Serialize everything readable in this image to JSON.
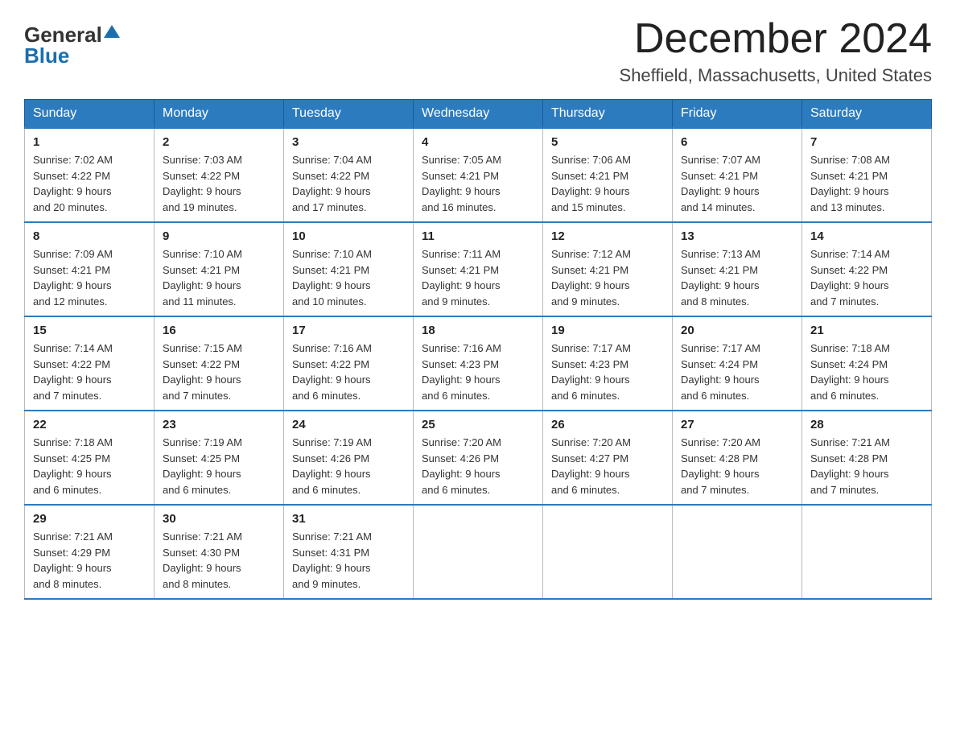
{
  "logo": {
    "general": "General",
    "blue": "Blue"
  },
  "title": {
    "month_year": "December 2024",
    "location": "Sheffield, Massachusetts, United States"
  },
  "days_header": [
    "Sunday",
    "Monday",
    "Tuesday",
    "Wednesday",
    "Thursday",
    "Friday",
    "Saturday"
  ],
  "weeks": [
    [
      {
        "day": "1",
        "sunrise": "7:02 AM",
        "sunset": "4:22 PM",
        "daylight": "9 hours and 20 minutes."
      },
      {
        "day": "2",
        "sunrise": "7:03 AM",
        "sunset": "4:22 PM",
        "daylight": "9 hours and 19 minutes."
      },
      {
        "day": "3",
        "sunrise": "7:04 AM",
        "sunset": "4:22 PM",
        "daylight": "9 hours and 17 minutes."
      },
      {
        "day": "4",
        "sunrise": "7:05 AM",
        "sunset": "4:21 PM",
        "daylight": "9 hours and 16 minutes."
      },
      {
        "day": "5",
        "sunrise": "7:06 AM",
        "sunset": "4:21 PM",
        "daylight": "9 hours and 15 minutes."
      },
      {
        "day": "6",
        "sunrise": "7:07 AM",
        "sunset": "4:21 PM",
        "daylight": "9 hours and 14 minutes."
      },
      {
        "day": "7",
        "sunrise": "7:08 AM",
        "sunset": "4:21 PM",
        "daylight": "9 hours and 13 minutes."
      }
    ],
    [
      {
        "day": "8",
        "sunrise": "7:09 AM",
        "sunset": "4:21 PM",
        "daylight": "9 hours and 12 minutes."
      },
      {
        "day": "9",
        "sunrise": "7:10 AM",
        "sunset": "4:21 PM",
        "daylight": "9 hours and 11 minutes."
      },
      {
        "day": "10",
        "sunrise": "7:10 AM",
        "sunset": "4:21 PM",
        "daylight": "9 hours and 10 minutes."
      },
      {
        "day": "11",
        "sunrise": "7:11 AM",
        "sunset": "4:21 PM",
        "daylight": "9 hours and 9 minutes."
      },
      {
        "day": "12",
        "sunrise": "7:12 AM",
        "sunset": "4:21 PM",
        "daylight": "9 hours and 9 minutes."
      },
      {
        "day": "13",
        "sunrise": "7:13 AM",
        "sunset": "4:21 PM",
        "daylight": "9 hours and 8 minutes."
      },
      {
        "day": "14",
        "sunrise": "7:14 AM",
        "sunset": "4:22 PM",
        "daylight": "9 hours and 7 minutes."
      }
    ],
    [
      {
        "day": "15",
        "sunrise": "7:14 AM",
        "sunset": "4:22 PM",
        "daylight": "9 hours and 7 minutes."
      },
      {
        "day": "16",
        "sunrise": "7:15 AM",
        "sunset": "4:22 PM",
        "daylight": "9 hours and 7 minutes."
      },
      {
        "day": "17",
        "sunrise": "7:16 AM",
        "sunset": "4:22 PM",
        "daylight": "9 hours and 6 minutes."
      },
      {
        "day": "18",
        "sunrise": "7:16 AM",
        "sunset": "4:23 PM",
        "daylight": "9 hours and 6 minutes."
      },
      {
        "day": "19",
        "sunrise": "7:17 AM",
        "sunset": "4:23 PM",
        "daylight": "9 hours and 6 minutes."
      },
      {
        "day": "20",
        "sunrise": "7:17 AM",
        "sunset": "4:24 PM",
        "daylight": "9 hours and 6 minutes."
      },
      {
        "day": "21",
        "sunrise": "7:18 AM",
        "sunset": "4:24 PM",
        "daylight": "9 hours and 6 minutes."
      }
    ],
    [
      {
        "day": "22",
        "sunrise": "7:18 AM",
        "sunset": "4:25 PM",
        "daylight": "9 hours and 6 minutes."
      },
      {
        "day": "23",
        "sunrise": "7:19 AM",
        "sunset": "4:25 PM",
        "daylight": "9 hours and 6 minutes."
      },
      {
        "day": "24",
        "sunrise": "7:19 AM",
        "sunset": "4:26 PM",
        "daylight": "9 hours and 6 minutes."
      },
      {
        "day": "25",
        "sunrise": "7:20 AM",
        "sunset": "4:26 PM",
        "daylight": "9 hours and 6 minutes."
      },
      {
        "day": "26",
        "sunrise": "7:20 AM",
        "sunset": "4:27 PM",
        "daylight": "9 hours and 6 minutes."
      },
      {
        "day": "27",
        "sunrise": "7:20 AM",
        "sunset": "4:28 PM",
        "daylight": "9 hours and 7 minutes."
      },
      {
        "day": "28",
        "sunrise": "7:21 AM",
        "sunset": "4:28 PM",
        "daylight": "9 hours and 7 minutes."
      }
    ],
    [
      {
        "day": "29",
        "sunrise": "7:21 AM",
        "sunset": "4:29 PM",
        "daylight": "9 hours and 8 minutes."
      },
      {
        "day": "30",
        "sunrise": "7:21 AM",
        "sunset": "4:30 PM",
        "daylight": "9 hours and 8 minutes."
      },
      {
        "day": "31",
        "sunrise": "7:21 AM",
        "sunset": "4:31 PM",
        "daylight": "9 hours and 9 minutes."
      },
      null,
      null,
      null,
      null
    ]
  ],
  "cell_labels": {
    "sunrise": "Sunrise:",
    "sunset": "Sunset:",
    "daylight": "Daylight:"
  }
}
